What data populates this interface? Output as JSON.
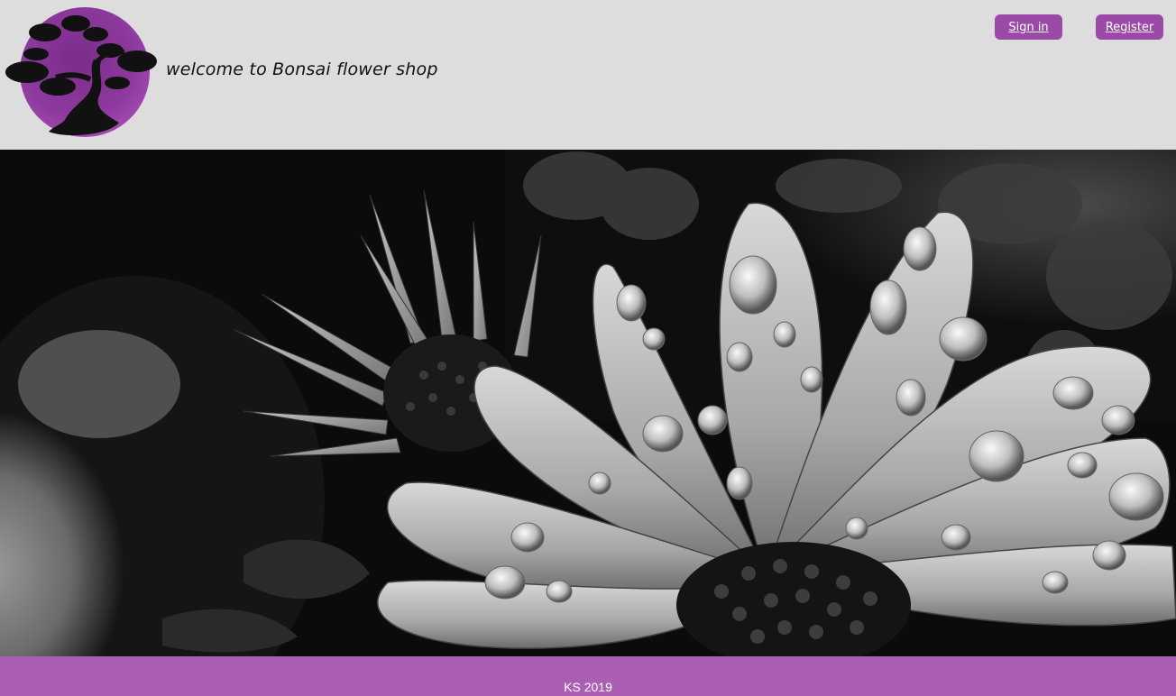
{
  "header": {
    "title": "welcome to Bonsai flower shop",
    "logo_icon": "bonsai-tree-logo",
    "accent_color": "#9b4aa8"
  },
  "auth": {
    "signin_label": "Sign in",
    "register_label": "Register"
  },
  "hero": {
    "image_icon": "daisy-flower-with-water-drops-photo"
  },
  "footer": {
    "text": "KS 2019",
    "color": "#ab5fb3"
  }
}
